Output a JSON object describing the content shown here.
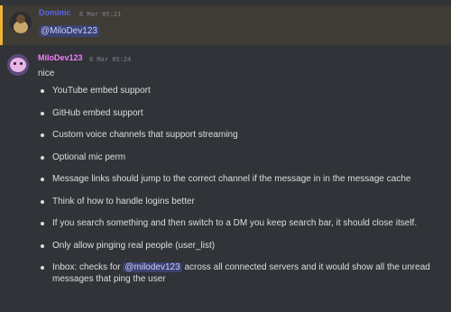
{
  "messages": [
    {
      "author": "Dominic",
      "author_color": "#5865f2",
      "timestamp": "6 Mar 05:21",
      "mention": "@MiloDev123",
      "highlighted": true
    },
    {
      "author": "MiloDev123",
      "author_color": "#f47fff",
      "timestamp": "6 Mar 05:24",
      "text": "nice",
      "list": [
        "YouTube embed support",
        "GitHub embed support",
        "Custom voice channels that support streaming",
        "Optional mic perm",
        "Message links should jump to the correct channel if the message in in the message cache",
        "Think of how to handle logins better",
        "If you search something and then switch to a DM you keep search bar, it should close itself.",
        "Only allow pinging real people (user_list)"
      ],
      "last_item": {
        "prefix": "Inbox: checks for ",
        "mention": "@milodev123",
        "suffix": " across all connected servers and it would show all the unread messages that ping the user"
      }
    }
  ],
  "colors": {
    "background": "#313338",
    "mention_highlight_bg": "#3f3c35",
    "mention_highlight_border": "#f0b232",
    "mention_pill_bg": "#3c4270",
    "mention_pill_text": "#c9cdfb"
  }
}
